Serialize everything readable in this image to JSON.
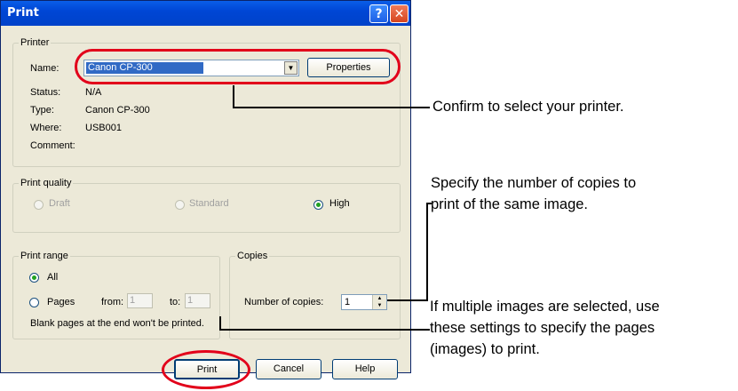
{
  "dialog": {
    "title": "Print",
    "help_button": "?",
    "close_button": "✕"
  },
  "printer": {
    "legend": "Printer",
    "name_label": "Name:",
    "name_value": "Canon CP-300",
    "properties_button": "Properties",
    "status_label": "Status:",
    "status_value": "N/A",
    "type_label": "Type:",
    "type_value": "Canon CP-300",
    "where_label": "Where:",
    "where_value": "USB001",
    "comment_label": "Comment:"
  },
  "quality": {
    "legend": "Print quality",
    "options": [
      "Draft",
      "Standard",
      "High"
    ],
    "selected": "High"
  },
  "range": {
    "legend": "Print range",
    "all_label": "All",
    "pages_label": "Pages",
    "from_label": "from:",
    "from_value": "1",
    "to_label": "to:",
    "to_value": "1",
    "note": "Blank pages at the end won't be printed.",
    "selected": "All"
  },
  "copies": {
    "legend": "Copies",
    "label": "Number of copies:",
    "value": "1"
  },
  "buttons": {
    "print": "Print",
    "cancel": "Cancel",
    "help": "Help"
  },
  "callouts": {
    "printer": "Confirm to select your printer.",
    "copies": [
      "Specify the number of copies to",
      "print of the same image."
    ],
    "range": [
      "If multiple images are selected, use",
      "these settings to specify the pages",
      "(images) to print."
    ]
  },
  "colors": {
    "highlight": "#e2001a",
    "titlebar": "#0046d5",
    "dialog_bg": "#ece9d8"
  }
}
